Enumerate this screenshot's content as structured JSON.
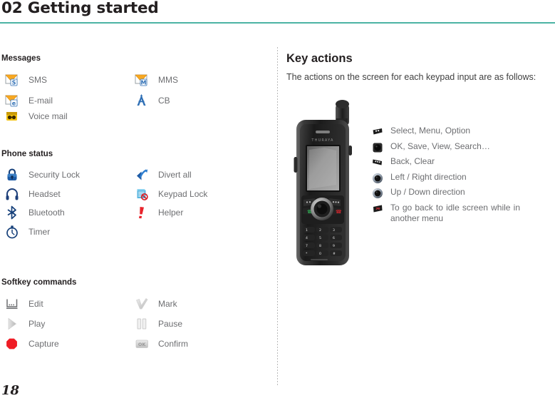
{
  "header": {
    "chapter_title": "02 Getting started",
    "rule_color": "#4cb3a4"
  },
  "page_number": "18",
  "left_column": {
    "sections": [
      {
        "heading": "Messages",
        "items_left": [
          {
            "icon": "sms-envelope-icon",
            "label": "SMS"
          },
          {
            "icon": "email-envelope-icon",
            "label": "E-mail"
          },
          {
            "icon": "voice-mail-icon",
            "label": "Voice mail"
          }
        ],
        "items_right": [
          {
            "icon": "mms-envelope-icon",
            "label": "MMS"
          },
          {
            "icon": "cb-broadcast-icon",
            "label": "CB"
          }
        ]
      },
      {
        "heading": "Phone status",
        "items_left": [
          {
            "icon": "padlock-icon",
            "label": "Security Lock"
          },
          {
            "icon": "headset-icon",
            "label": "Headset"
          },
          {
            "icon": "bluetooth-icon",
            "label": "Bluetooth"
          },
          {
            "icon": "stopwatch-timer-icon",
            "label": "Timer"
          }
        ],
        "items_right": [
          {
            "icon": "divert-arrow-icon",
            "label": "Divert all"
          },
          {
            "icon": "keypad-lock-icon",
            "label": "Keypad Lock"
          },
          {
            "icon": "helper-exclamation-icon",
            "label": "Helper"
          }
        ]
      },
      {
        "heading": "Softkey commands",
        "items_left": [
          {
            "icon": "edit-icon",
            "label": "Edit"
          },
          {
            "icon": "play-icon",
            "label": "Play"
          },
          {
            "icon": "capture-record-icon",
            "label": "Capture"
          }
        ],
        "items_right": [
          {
            "icon": "mark-check-icon",
            "label": "Mark"
          },
          {
            "icon": "pause-icon",
            "label": "Pause"
          },
          {
            "icon": "confirm-ok-icon",
            "label": "Confirm"
          }
        ]
      }
    ]
  },
  "right_column": {
    "title": "Key actions",
    "intro": "The actions on the screen for each keypad input are as follows:",
    "phone": {
      "name": "thuraya-satellite-phone",
      "brand_text": "THURAYA",
      "keypad_labels": [
        "1",
        "2",
        "3",
        "4",
        "5",
        "6",
        "7",
        "8",
        "9",
        "*",
        "0",
        "#"
      ]
    },
    "key_actions": [
      {
        "icon": "left-softkey-icon",
        "text": "Select, Menu, Option"
      },
      {
        "icon": "center-ok-key-icon",
        "text": "OK, Save, View, Search…"
      },
      {
        "icon": "right-softkey-icon",
        "text": "Back, Clear"
      },
      {
        "icon": "nav-left-right-key-icon",
        "text": "Left / Right direction"
      },
      {
        "icon": "nav-up-down-key-icon",
        "text": "Up / Down direction"
      },
      {
        "icon": "end-call-key-icon",
        "text": "To go back to idle screen while in another menu"
      }
    ]
  },
  "colors": {
    "accent_rule": "#4cb3a4",
    "heading_text": "#231f20",
    "body_text": "#6d6e71",
    "intro_text": "#404040",
    "icon_orange": "#f5a623",
    "icon_blue": "#1f5fa8",
    "icon_red": "#e01b22",
    "icon_gray": "#c8c8c8"
  }
}
